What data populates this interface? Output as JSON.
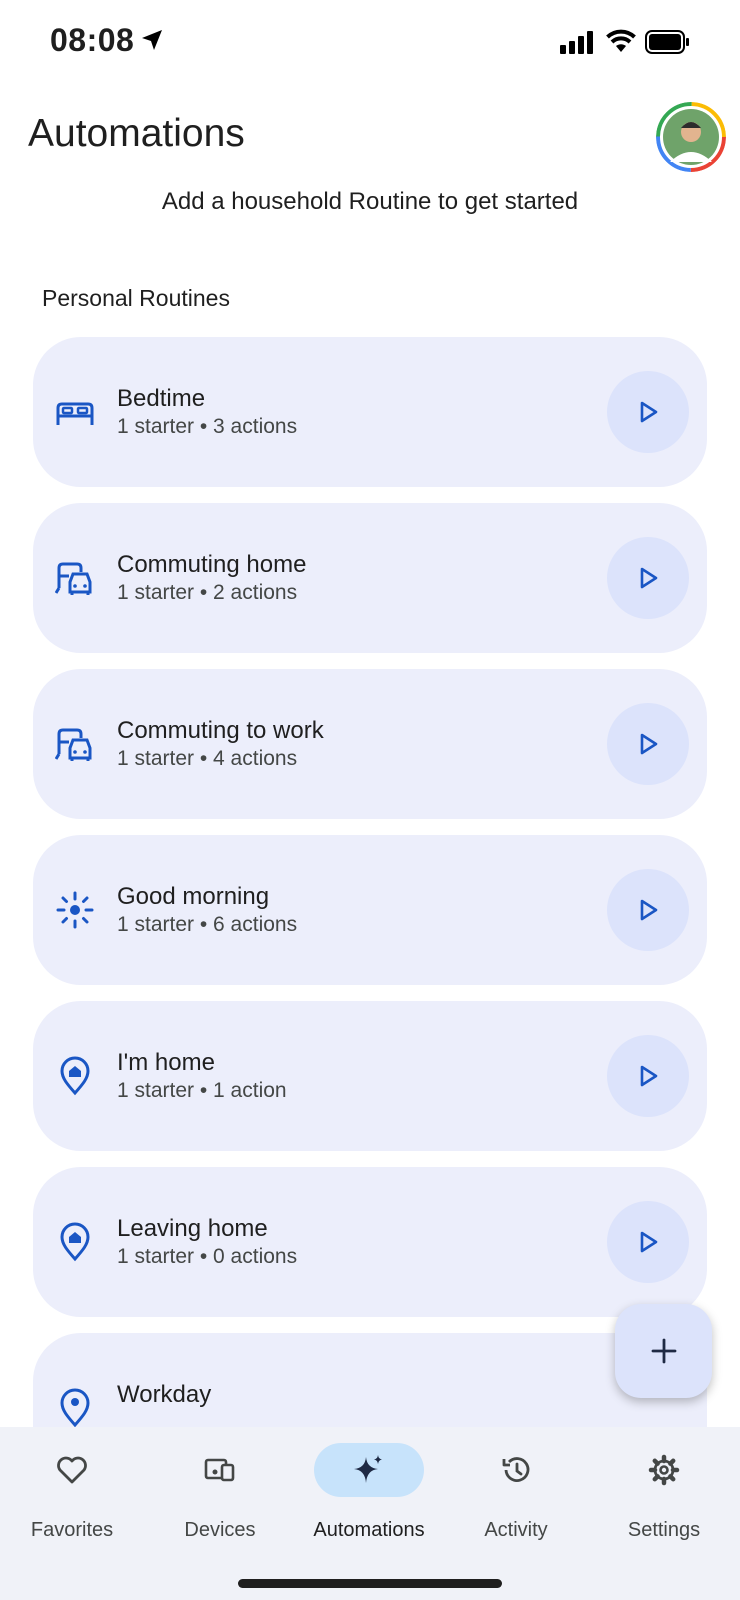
{
  "status_bar": {
    "time": "08:08"
  },
  "header": {
    "title": "Automations",
    "subtitle": "Add a household Routine to get started"
  },
  "section": {
    "heading": "Personal Routines"
  },
  "routines": [
    {
      "name": "Bedtime",
      "summary": "1 starter • 3 actions",
      "icon": "bed-icon"
    },
    {
      "name": "Commuting home",
      "summary": "1 starter • 2 actions",
      "icon": "commute-icon"
    },
    {
      "name": "Commuting to work",
      "summary": "1 starter • 4 actions",
      "icon": "commute-icon"
    },
    {
      "name": "Good morning",
      "summary": "1 starter • 6 actions",
      "icon": "sun-icon"
    },
    {
      "name": "I'm home",
      "summary": "1 starter • 1 action",
      "icon": "home-pin-icon"
    },
    {
      "name": "Leaving home",
      "summary": "1 starter • 0 actions",
      "icon": "home-pin-icon"
    },
    {
      "name": "Workday",
      "summary": "",
      "icon": "person-pin-icon"
    }
  ],
  "fab": {
    "icon": "plus-icon"
  },
  "nav": {
    "items": [
      {
        "label": "Favorites",
        "icon": "heart-icon",
        "active": false
      },
      {
        "label": "Devices",
        "icon": "devices-icon",
        "active": false
      },
      {
        "label": "Automations",
        "icon": "sparkle-icon",
        "active": true
      },
      {
        "label": "Activity",
        "icon": "history-icon",
        "active": false
      },
      {
        "label": "Settings",
        "icon": "gear-icon",
        "active": false
      }
    ]
  },
  "colors": {
    "card_bg": "#eceefb",
    "play_bg": "#dce3fb",
    "accent": "#1a56c4",
    "nav_active_bg": "#c7e3fb"
  }
}
